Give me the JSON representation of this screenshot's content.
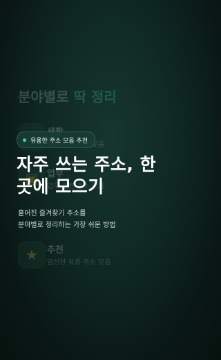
{
  "background": {
    "title_prefix": "분야별로 ",
    "title_accent": "딱 정리",
    "items": [
      {
        "icon": "home-icon",
        "glyph": "⌂",
        "name": "생활",
        "desc": "일상 유용 주소 모음"
      },
      {
        "icon": "briefcase-icon",
        "glyph": "▣",
        "name": "업무",
        "desc": "업무 관련 주소 모음"
      },
      {
        "icon": "star-icon",
        "glyph": "★",
        "name": "추천",
        "desc": "엄선한 유용 주소 모음"
      }
    ]
  },
  "badge": {
    "text": "유용한 주소 모음 추천"
  },
  "headline": {
    "line1": "자주 쓰는 주소, 한",
    "line2": "곳에 모으기"
  },
  "subtitle": {
    "line1": "흩어진 즐겨찾기 주소를",
    "line2": "분야별로 정리하는 가장 쉬운 방법"
  },
  "colors": {
    "accent": "#3fc79a",
    "dot": "#3fd39c",
    "background": "#0f2722"
  }
}
